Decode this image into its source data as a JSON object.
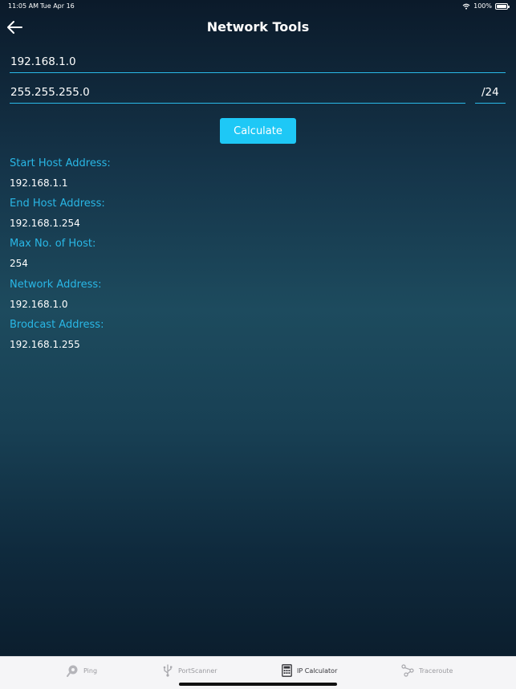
{
  "status_bar": {
    "time": "11:05 AM",
    "date": "Tue Apr 16",
    "battery": "100%"
  },
  "nav": {
    "title": "Network Tools"
  },
  "form": {
    "ip_address": "192.168.1.0",
    "subnet_mask": "255.255.255.0",
    "cidr": "/24",
    "calculate_label": "Calculate"
  },
  "results": [
    {
      "label": "Start Host Address:",
      "value": "192.168.1.1"
    },
    {
      "label": "End Host Address:",
      "value": "192.168.1.254"
    },
    {
      "label": "Max No. of Host:",
      "value": "254"
    },
    {
      "label": "Network Address:",
      "value": "192.168.1.0"
    },
    {
      "label": "Brodcast Address:",
      "value": "192.168.1.255"
    }
  ],
  "tabs": [
    {
      "label": "Ping",
      "icon": "ping-icon",
      "active": false
    },
    {
      "label": "PortScanner",
      "icon": "usb-icon",
      "active": false
    },
    {
      "label": "IP Calculator",
      "icon": "calculator-icon",
      "active": true
    },
    {
      "label": "Traceroute",
      "icon": "traceroute-icon",
      "active": false
    }
  ],
  "colors": {
    "accent": "#1ec8f6",
    "label": "#29b7e6",
    "tab_active": "#333338",
    "tab_inactive": "#9a9a9f"
  }
}
